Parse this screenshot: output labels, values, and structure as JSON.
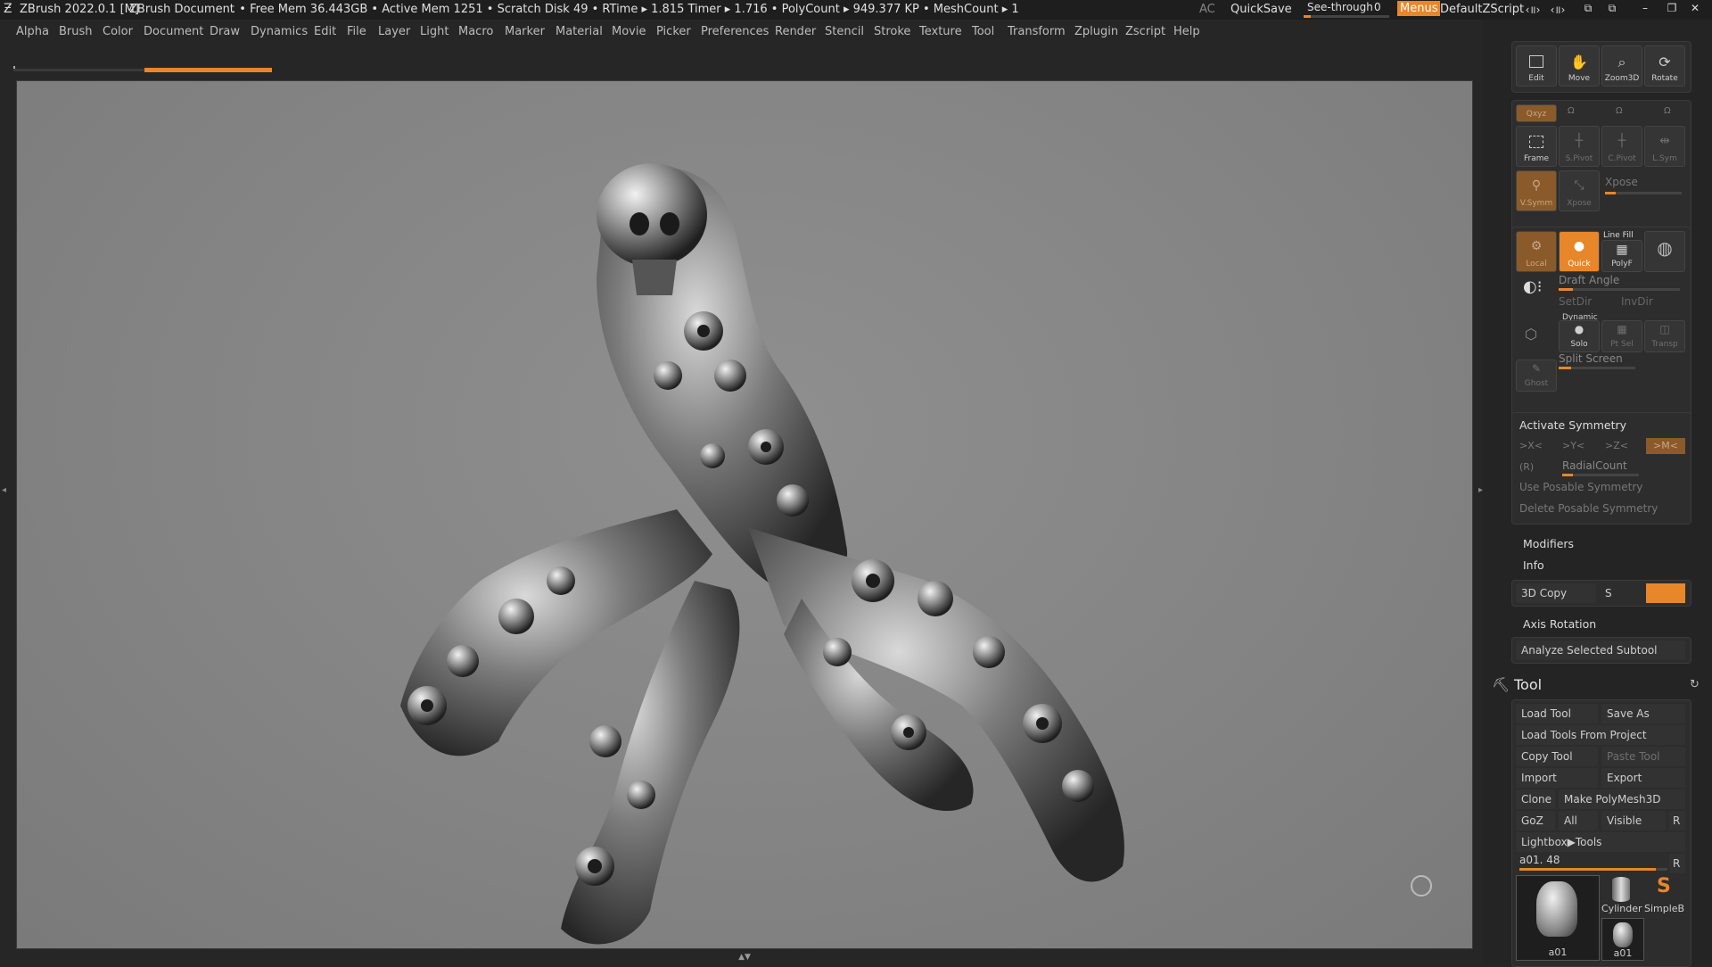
{
  "titlebar": {
    "app": "ZBrush 2022.0.1 [M]",
    "document": "ZBrush Document",
    "stats": ". • Free Mem 36.443GB • Active Mem 1251 • Scratch Disk 49 •  RTime ▸ 1.815 Timer ▸ 1.716 • PolyCount ▸ 949.377 KP  • MeshCount ▸ 1",
    "ac": "AC",
    "quicksave": "QuickSave",
    "seethrough_label": "See-through",
    "seethrough_value": "0",
    "menus": "Menus",
    "script": "DefaultZScript"
  },
  "menu": [
    "Alpha",
    "Brush",
    "Color",
    "Document",
    "Draw",
    "Dynamics",
    "Edit",
    "File",
    "Layer",
    "Light",
    "Macro",
    "Marker",
    "Material",
    "Movie",
    "Picker",
    "Preferences",
    "Render",
    "Stencil",
    "Stroke",
    "Texture",
    "Tool",
    "Transform",
    "Zplugin",
    "Zscript",
    "Help"
  ],
  "nav_buttons": {
    "edit": "Edit",
    "move": "Move",
    "zoom": "Zoom3D",
    "rotate": "Rotate"
  },
  "transform": {
    "xyz": "Qxyz",
    "frame": "Frame",
    "spivot": "S.Pivot",
    "cpivot": "C.Pivot",
    "lsym": "L.Sym",
    "vsym": "V.Symm",
    "xpose": "Xpose",
    "xpose_label": "Xpose",
    "local": "Local",
    "quick": "Quick",
    "linefill": "Line Fill",
    "polyf": "PolyF",
    "draft_angle": "Draft Angle",
    "setdir": "SetDir",
    "invdir": "InvDir",
    "dynamic": "Dynamic",
    "solo": "Solo",
    "ptsel": "Pt Sel",
    "transp": "Transp",
    "split_screen": "Split Screen",
    "ghost": "Ghost"
  },
  "symmetry": {
    "activate": "Activate Symmetry",
    "x": ">X<",
    "y": ">Y<",
    "z": ">Z<",
    "m": ">M<",
    "r": "(R)",
    "radialcount": "RadialCount",
    "use_posable": "Use Posable Symmetry",
    "delete_posable": "Delete Posable Symmetry"
  },
  "sections": {
    "modifiers": "Modifiers",
    "info": "Info",
    "copy3d": "3D Copy",
    "s": "S",
    "axis_rotation": "Axis Rotation",
    "analyze": "Analyze Selected Subtool"
  },
  "tool": {
    "title": "Tool",
    "load_tool": "Load Tool",
    "save_as": "Save As",
    "load_from_project": "Load Tools From Project",
    "copy_tool": "Copy Tool",
    "paste_tool": "Paste Tool",
    "import": "Import",
    "export": "Export",
    "clone": "Clone",
    "make_polymesh": "Make PolyMesh3D",
    "goz": "GoZ",
    "all": "All",
    "visible": "Visible",
    "r": "R",
    "lightbox": "Lightbox▶Tools",
    "current": "a01. 48",
    "r2": "R",
    "thumb1": "a01",
    "thumb2": "Cylinder",
    "thumb3": "SimpleB",
    "thumb4": "a01"
  }
}
